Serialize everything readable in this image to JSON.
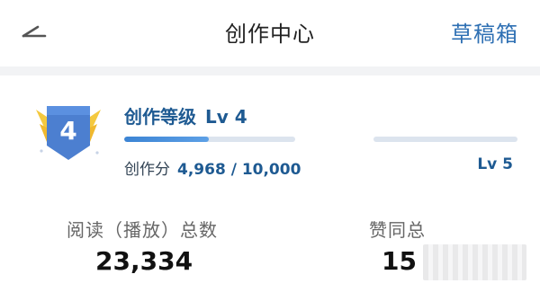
{
  "header": {
    "title": "创作中心",
    "drafts_label": "草稿箱"
  },
  "level": {
    "badge_number": "4",
    "label": "创作等级",
    "current": "Lv 4",
    "progress": 0.4968,
    "score_label": "创作分",
    "score_value": "4,968 / 10,000",
    "next": "Lv 5"
  },
  "stats": {
    "reads_label": "阅读（播放）总数",
    "reads_value": "23,334",
    "likes_label": "赞同总",
    "likes_value": "15"
  },
  "colors": {
    "accent": "#1e5a92",
    "drafts": "#2d6fb3",
    "badge": "#4c7fd0",
    "badge_wings": "#f4c93f"
  },
  "icons": {
    "back": "back-arrow-icon",
    "badge": "level-badge-icon"
  }
}
